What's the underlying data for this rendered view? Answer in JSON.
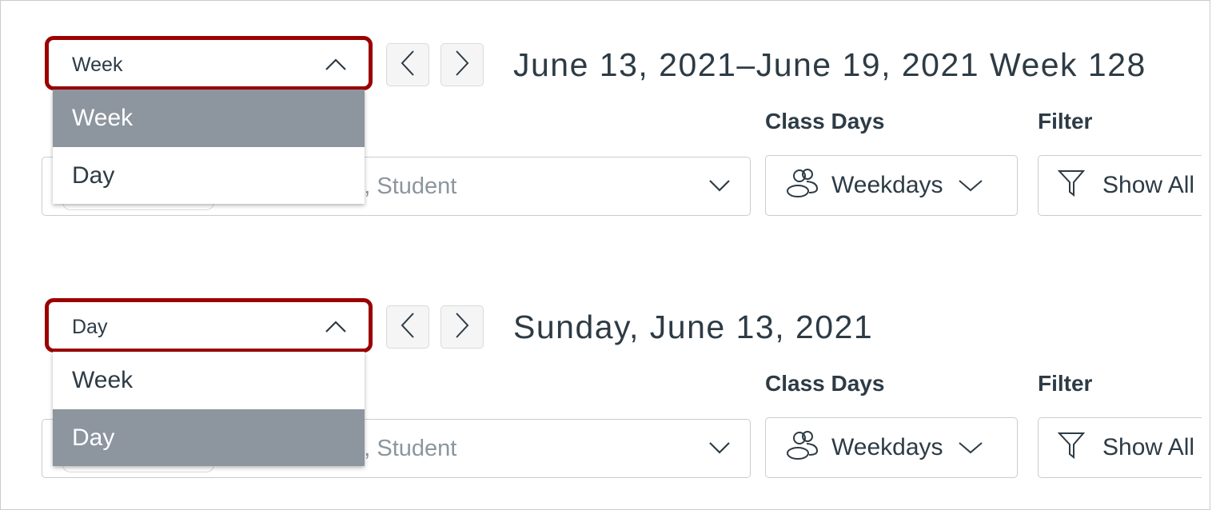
{
  "panels": [
    {
      "select_value": "Week",
      "title": "June 13, 2021–June 19, 2021 Week 128",
      "options": [
        "Week",
        "Day"
      ],
      "selected_option": 0,
      "search_placeholder": "on, Student",
      "class_days_label": "Class Days",
      "class_days_value": "Weekdays",
      "filter_label": "Filter",
      "filter_value": "Show All"
    },
    {
      "select_value": "Day",
      "title": "Sunday, June 13, 2021",
      "options": [
        "Week",
        "Day"
      ],
      "selected_option": 1,
      "search_placeholder": "on, Student",
      "class_days_label": "Class Days",
      "class_days_value": "Weekdays",
      "filter_label": "Filter",
      "filter_value": "Show All"
    }
  ],
  "colors": {
    "highlight": "#9b0000",
    "selected_option_bg": "#8d959f",
    "text": "#2d3b45"
  },
  "icons": {
    "select": "chevron-up-icon",
    "prev": "chevron-left-icon",
    "next": "chevron-right-icon",
    "class_days": "users-icon",
    "filter": "filter-icon",
    "dropdown": "chevron-down-icon"
  }
}
